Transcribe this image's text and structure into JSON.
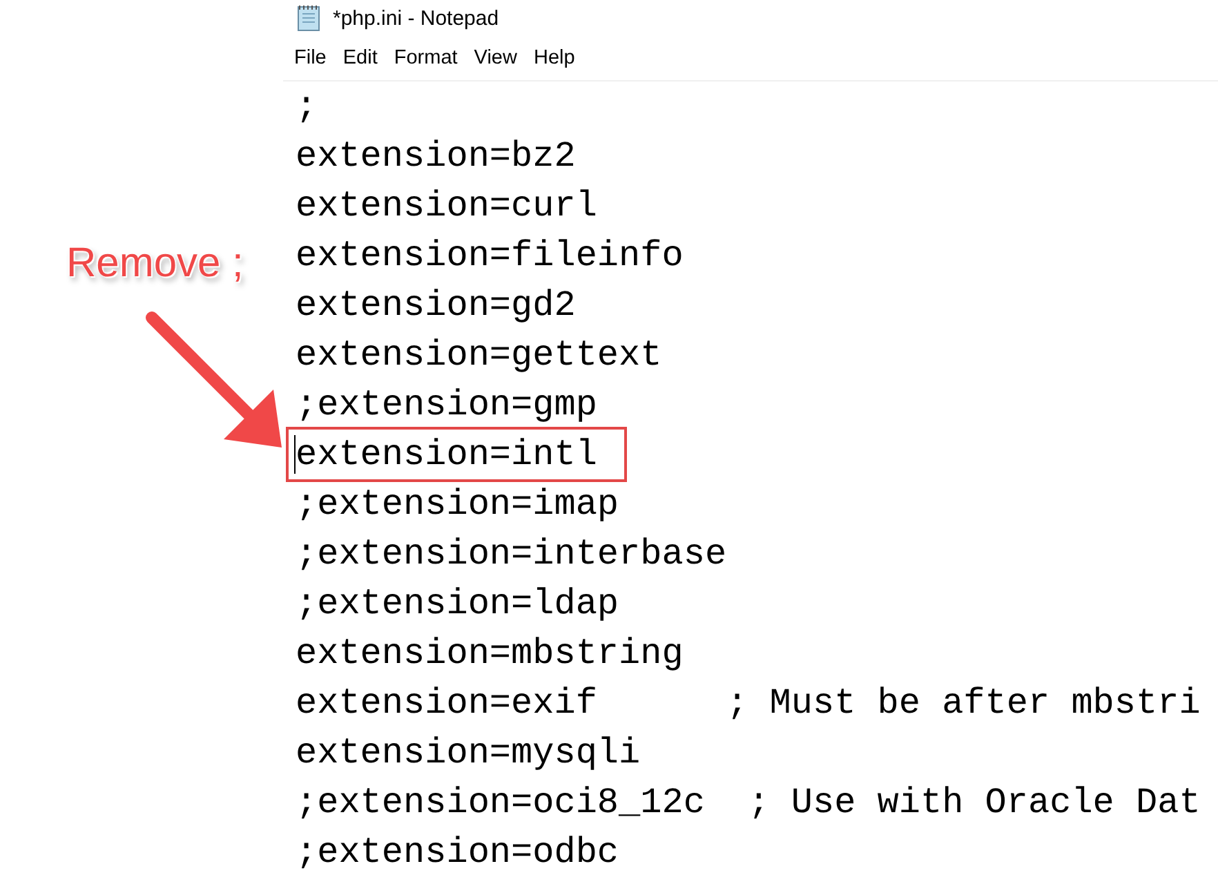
{
  "window": {
    "title": "*php.ini - Notepad"
  },
  "menu": [
    "File",
    "Edit",
    "Format",
    "View",
    "Help"
  ],
  "lines": [
    {
      "text": ";",
      "boxed": false,
      "caret": false
    },
    {
      "text": "extension=bz2",
      "boxed": false,
      "caret": false
    },
    {
      "text": "extension=curl",
      "boxed": false,
      "caret": false
    },
    {
      "text": "extension=fileinfo",
      "boxed": false,
      "caret": false
    },
    {
      "text": "extension=gd2",
      "boxed": false,
      "caret": false
    },
    {
      "text": "extension=gettext",
      "boxed": false,
      "caret": false
    },
    {
      "text": ";extension=gmp",
      "boxed": false,
      "caret": false
    },
    {
      "text": "extension=intl",
      "boxed": true,
      "caret": true
    },
    {
      "text": ";extension=imap",
      "boxed": false,
      "caret": false
    },
    {
      "text": ";extension=interbase",
      "boxed": false,
      "caret": false
    },
    {
      "text": ";extension=ldap",
      "boxed": false,
      "caret": false
    },
    {
      "text": "extension=mbstring",
      "boxed": false,
      "caret": false
    },
    {
      "text": "extension=exif      ; Must be after mbstri",
      "boxed": false,
      "caret": false
    },
    {
      "text": "extension=mysqli",
      "boxed": false,
      "caret": false
    },
    {
      "text": ";extension=oci8_12c  ; Use with Oracle Dat",
      "boxed": false,
      "caret": false
    },
    {
      "text": ";extension=odbc",
      "boxed": false,
      "caret": false
    }
  ],
  "annotation": {
    "label": "Remove ;"
  }
}
